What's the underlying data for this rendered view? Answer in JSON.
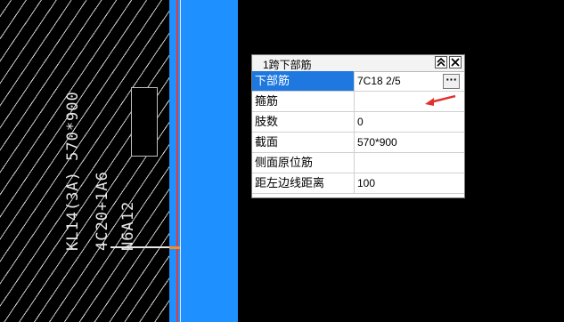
{
  "drawing": {
    "beam_label_line1": "KL14(3A) 570*900",
    "beam_label_line2": "4C20+1A6",
    "beam_label_line3": "N6A12"
  },
  "panel": {
    "title": "1跨下部筋",
    "collapse_icon": "double-chevron-up-icon",
    "close_icon": "close-icon",
    "rows": [
      {
        "name": "下部筋",
        "value": "7C18 2/5"
      },
      {
        "name": "箍筋",
        "value": ""
      },
      {
        "name": "肢数",
        "value": "0"
      },
      {
        "name": "截面",
        "value": "570*900"
      },
      {
        "name": "侧面原位筋",
        "value": ""
      },
      {
        "name": "距左边线距离",
        "value": "100"
      }
    ],
    "ellipsis_label": "···"
  },
  "colors": {
    "column_band": "#1e90ff",
    "selected_row": "#1e78e0",
    "annotation_arrow": "#e0312f"
  }
}
